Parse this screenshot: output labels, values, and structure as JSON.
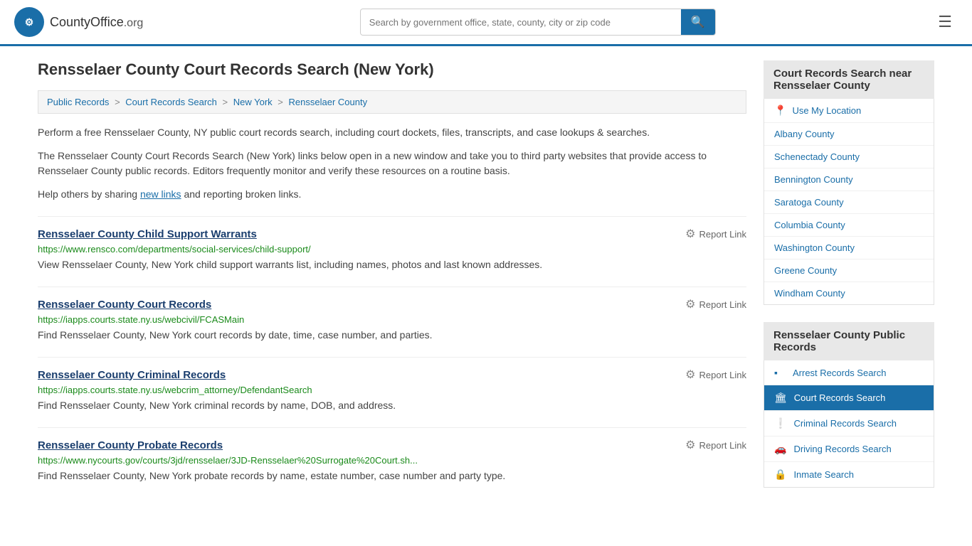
{
  "header": {
    "logo_text": "CountyOffice",
    "logo_suffix": ".org",
    "search_placeholder": "Search by government office, state, county, city or zip code",
    "search_icon": "🔍"
  },
  "page": {
    "title": "Rensselaer County Court Records Search (New York)"
  },
  "breadcrumb": {
    "items": [
      {
        "label": "Public Records",
        "href": "#"
      },
      {
        "label": "Court Records Search",
        "href": "#"
      },
      {
        "label": "New York",
        "href": "#"
      },
      {
        "label": "Rensselaer County",
        "href": "#"
      }
    ]
  },
  "description": {
    "para1": "Perform a free Rensselaer County, NY public court records search, including court dockets, files, transcripts, and case lookups & searches.",
    "para2": "The Rensselaer County Court Records Search (New York) links below open in a new window and take you to third party websites that provide access to Rensselaer County public records. Editors frequently monitor and verify these resources on a routine basis.",
    "para3_before": "Help others by sharing ",
    "para3_link": "new links",
    "para3_after": " and reporting broken links."
  },
  "results": [
    {
      "title": "Rensselaer County Child Support Warrants",
      "url": "https://www.rensco.com/departments/social-services/child-support/",
      "desc": "View Rensselaer County, New York child support warrants list, including names, photos and last known addresses.",
      "report_label": "Report Link"
    },
    {
      "title": "Rensselaer County Court Records",
      "url": "https://iapps.courts.state.ny.us/webcivil/FCASMain",
      "desc": "Find Rensselaer County, New York court records by date, time, case number, and parties.",
      "report_label": "Report Link"
    },
    {
      "title": "Rensselaer County Criminal Records",
      "url": "https://iapps.courts.state.ny.us/webcrim_attorney/DefendantSearch",
      "desc": "Find Rensselaer County, New York criminal records by name, DOB, and address.",
      "report_label": "Report Link"
    },
    {
      "title": "Rensselaer County Probate Records",
      "url": "https://www.nycourts.gov/courts/3jd/rensselaer/3JD-Rensselaer%20Surrogate%20Court.sh...",
      "desc": "Find Rensselaer County, New York probate records by name, estate number, case number and party type.",
      "report_label": "Report Link"
    }
  ],
  "sidebar": {
    "nearby_header": "Court Records Search near Rensselaer County",
    "use_location": "Use My Location",
    "nearby_counties": [
      "Albany County",
      "Schenectady County",
      "Bennington County",
      "Saratoga County",
      "Columbia County",
      "Washington County",
      "Greene County",
      "Windham County"
    ],
    "public_records_header": "Rensselaer County Public Records",
    "public_records": [
      {
        "label": "Arrest Records Search",
        "icon": "▪",
        "active": false
      },
      {
        "label": "Court Records Search",
        "icon": "🏛",
        "active": true
      },
      {
        "label": "Criminal Records Search",
        "icon": "❕",
        "active": false
      },
      {
        "label": "Driving Records Search",
        "icon": "🚗",
        "active": false
      },
      {
        "label": "Inmate Search",
        "icon": "🔒",
        "active": false
      }
    ]
  }
}
